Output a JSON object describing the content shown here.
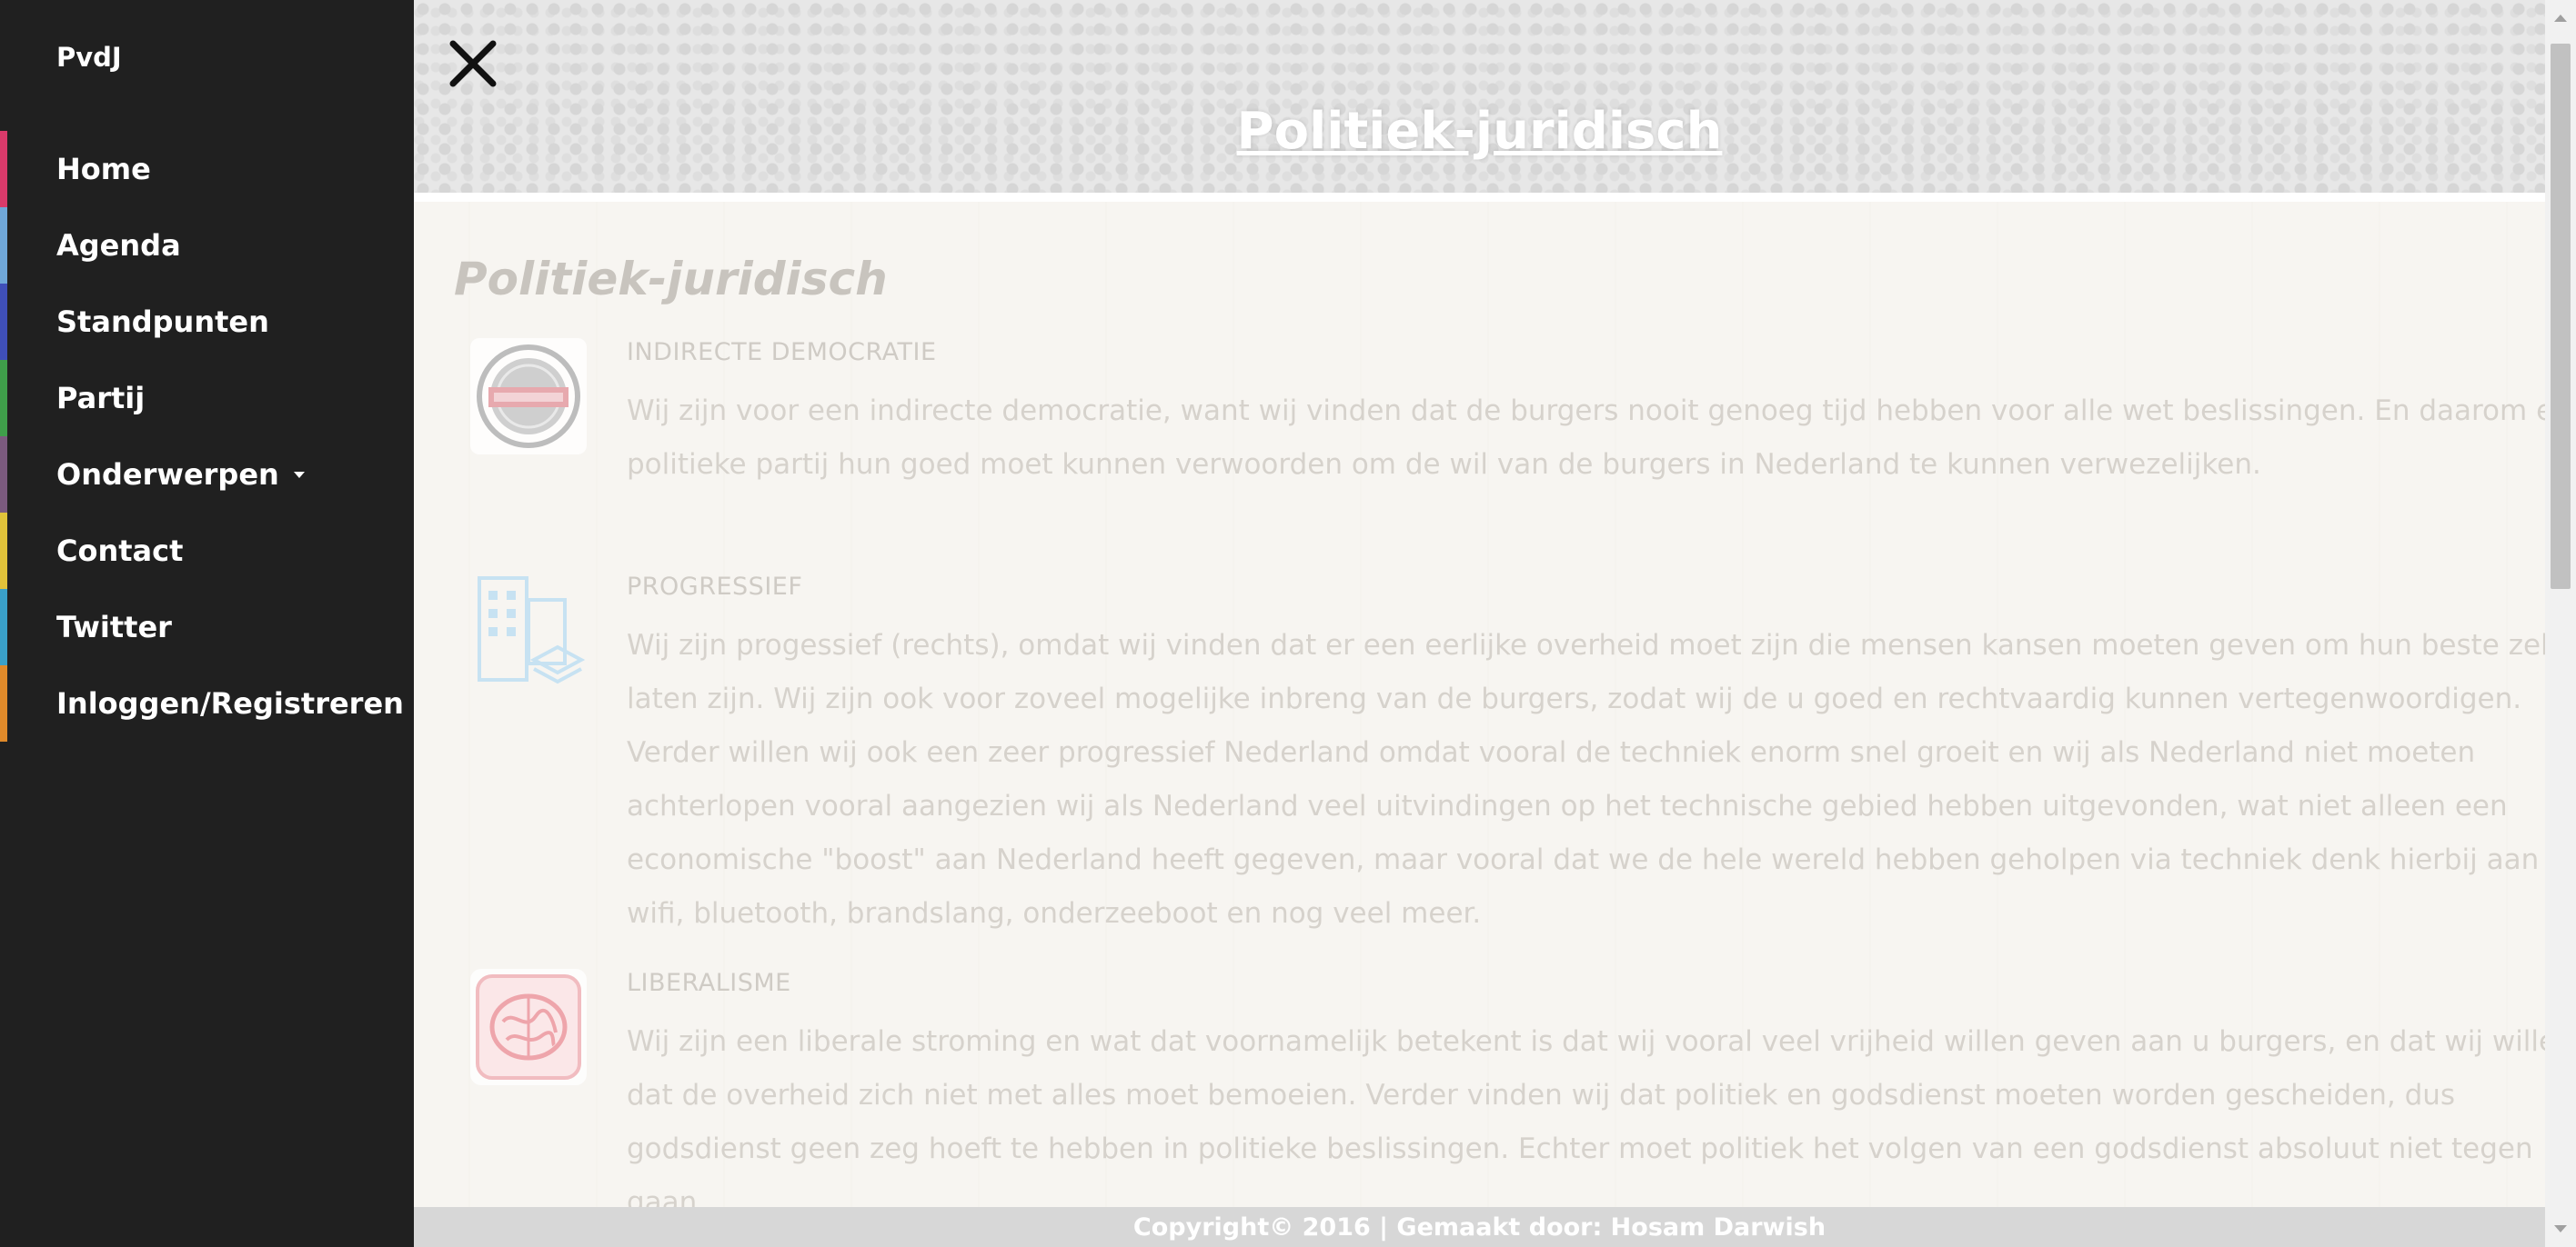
{
  "sidebar": {
    "brand": "PvdJ",
    "items": [
      {
        "label": "Home",
        "accent": "#d93a6a"
      },
      {
        "label": "Agenda",
        "accent": "#6fa7d8"
      },
      {
        "label": "Standpunten",
        "accent": "#3f4fb8"
      },
      {
        "label": "Partij",
        "accent": "#3f9e4a"
      },
      {
        "label": "Onderwerpen",
        "accent": "#7b5a7e",
        "has_dropdown": true
      },
      {
        "label": "Contact",
        "accent": "#e0c23a"
      },
      {
        "label": "Twitter",
        "accent": "#3aa0c8"
      },
      {
        "label": "Inloggen/Registreren",
        "accent": "#e08a2a"
      }
    ]
  },
  "header": {
    "title": "Politiek-juridisch",
    "close_icon": "close-icon"
  },
  "main": {
    "section_title": "Politiek-juridisch",
    "items": [
      {
        "title": "INDIRECTE DEMOCRATIE",
        "icon": "stamp-badge-icon",
        "text": "Wij zijn voor een indirecte democratie, want wij vinden dat de burgers nooit genoeg tijd hebben voor alle wet beslissingen. En daarom een politieke partij hun goed moet kunnen verwoorden om de wil van de burgers in Nederland te kunnen verwezelijken."
      },
      {
        "title": "PROGRESSIEF",
        "icon": "buildings-icon",
        "text": "Wij zijn progessief (rechts), omdat wij vinden dat er een eerlijke overheid moet zijn die mensen kansen moeten geven om hun beste zelf te laten zijn. Wij zijn ook voor zoveel mogelijke inbreng van de burgers, zodat wij de u goed en rechtvaardig kunnen vertegenwoordigen. Verder willen wij ook een zeer progressief Nederland omdat vooral de techniek enorm snel groeit en wij als Nederland niet moeten achterlopen vooral aangezien wij als Nederland veel uitvindingen op het technische gebied hebben uitgevonden, wat niet alleen een economische \"boost\" aan Nederland heeft gegeven, maar vooral dat we de hele wereld hebben geholpen via techniek denk hierbij aan wifi, bluetooth, brandslang, onderzeeboot en nog veel meer."
      },
      {
        "title": "LIBERALISME",
        "icon": "brain-icon",
        "text": "Wij zijn een liberale stroming en wat dat voornamelijk betekent is dat wij vooral veel vrijheid willen geven aan u burgers, en dat wij willen dat de overheid zich niet met alles moet bemoeien. Verder vinden wij dat politiek en godsdienst moeten worden gescheiden, dus godsdienst geen zeg hoeft te hebben in politieke beslissingen. Echter moet politiek het volgen van een godsdienst absoluut niet tegen gaan."
      }
    ]
  },
  "footer": {
    "text": "Copyright© 2016 | Gemaakt door: Hosam Darwish"
  }
}
